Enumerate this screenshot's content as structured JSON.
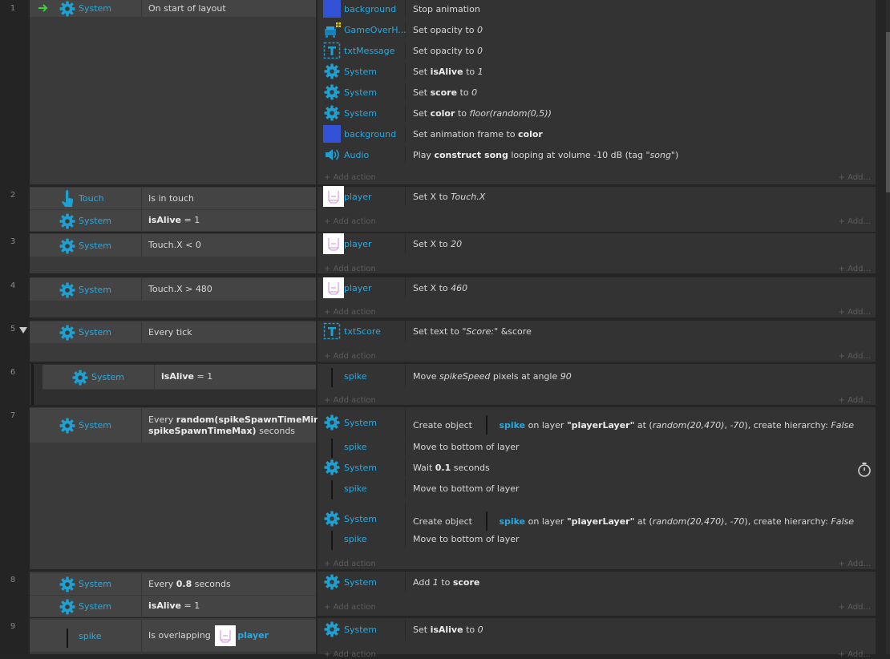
{
  "colors": {
    "object_name": "#29a9e0",
    "gear": "#1fa0d2",
    "background_swatch": "#3353d6",
    "trigger_arrow": "#3ccf3c"
  },
  "add_action": "Add action",
  "add_more": "Add...",
  "events": [
    {
      "num": "1",
      "conditions": [
        {
          "icon": "gear-icon",
          "object": "System",
          "text": "On start of layout",
          "trigger": true
        }
      ],
      "actions": [
        {
          "icon": "color-swatch-icon",
          "object": "background",
          "parts": [
            {
              "t": "Stop animation"
            }
          ]
        },
        {
          "icon": "sprite-icon",
          "object": "GameOverH...",
          "parts": [
            {
              "t": "Set opacity to "
            },
            {
              "t": "0",
              "i": 1
            }
          ]
        },
        {
          "icon": "text-object-icon",
          "object": "txtMessage",
          "parts": [
            {
              "t": "Set opacity to "
            },
            {
              "t": "0",
              "i": 1
            }
          ]
        },
        {
          "icon": "gear-icon",
          "object": "System",
          "parts": [
            {
              "t": "Set "
            },
            {
              "t": "isAlive",
              "b": 1
            },
            {
              "t": " to "
            },
            {
              "t": "1",
              "i": 1
            }
          ]
        },
        {
          "icon": "gear-icon",
          "object": "System",
          "parts": [
            {
              "t": "Set "
            },
            {
              "t": "score",
              "b": 1
            },
            {
              "t": " to "
            },
            {
              "t": "0",
              "i": 1
            }
          ]
        },
        {
          "icon": "gear-icon",
          "object": "System",
          "parts": [
            {
              "t": "Set "
            },
            {
              "t": "color",
              "b": 1
            },
            {
              "t": " to "
            },
            {
              "t": "floor(random(0,5))",
              "i": 1
            }
          ]
        },
        {
          "icon": "color-swatch-icon",
          "object": "background",
          "parts": [
            {
              "t": "Set animation frame to "
            },
            {
              "t": "color",
              "b": 1
            }
          ]
        },
        {
          "icon": "speaker-icon",
          "object": "Audio",
          "parts": [
            {
              "t": "Play "
            },
            {
              "t": "construct song",
              "b": 1
            },
            {
              "t": " looping at volume -10 dB (tag "
            },
            {
              "t": "\"song\"",
              "i": 1
            },
            {
              "t": ")"
            }
          ]
        }
      ]
    },
    {
      "num": "2",
      "conditions": [
        {
          "icon": "touch-icon",
          "object": "Touch",
          "parts": [
            {
              "t": "Is in touch"
            }
          ]
        },
        {
          "icon": "gear-icon",
          "object": "System",
          "parts": [
            {
              "t": "isAlive",
              "b": 1
            },
            {
              "t": " = 1"
            }
          ]
        }
      ],
      "actions": [
        {
          "icon": "player-icon",
          "object": "player",
          "parts": [
            {
              "t": "Set X to "
            },
            {
              "t": "Touch.X",
              "i": 1
            }
          ]
        }
      ]
    },
    {
      "num": "3",
      "conditions": [
        {
          "icon": "gear-icon",
          "object": "System",
          "parts": [
            {
              "t": "Touch.X < 0"
            }
          ]
        }
      ],
      "actions": [
        {
          "icon": "player-icon",
          "object": "player",
          "parts": [
            {
              "t": "Set X to "
            },
            {
              "t": "20",
              "i": 1
            }
          ]
        }
      ]
    },
    {
      "num": "4",
      "conditions": [
        {
          "icon": "gear-icon",
          "object": "System",
          "parts": [
            {
              "t": "Touch.X > 480"
            }
          ]
        }
      ],
      "actions": [
        {
          "icon": "player-icon",
          "object": "player",
          "parts": [
            {
              "t": "Set X to "
            },
            {
              "t": "460",
              "i": 1
            }
          ]
        }
      ]
    },
    {
      "num": "5",
      "collapsible": true,
      "conditions": [
        {
          "icon": "gear-icon",
          "object": "System",
          "parts": [
            {
              "t": "Every tick"
            }
          ]
        }
      ],
      "actions": [
        {
          "icon": "text-object-icon",
          "object": "txtScore",
          "parts": [
            {
              "t": "Set text to "
            },
            {
              "t": "\"Score:\"",
              "i": 1
            },
            {
              "t": " &score"
            }
          ]
        }
      ]
    },
    {
      "num": "6",
      "sub": true,
      "conditions": [
        {
          "icon": "gear-icon",
          "object": "System",
          "parts": [
            {
              "t": "isAlive",
              "b": 1
            },
            {
              "t": " = 1"
            }
          ]
        }
      ],
      "actions": [
        {
          "icon": "spike-icon",
          "object": "spike",
          "parts": [
            {
              "t": "Move "
            },
            {
              "t": "spikeSpeed",
              "i": 1
            },
            {
              "t": " pixels at angle "
            },
            {
              "t": "90",
              "i": 1
            }
          ]
        }
      ]
    },
    {
      "num": "7",
      "conditions": [
        {
          "icon": "gear-icon",
          "object": "System",
          "parts": [
            {
              "t": "Every "
            },
            {
              "t": "random(spikeSpawnTimeMin,",
              "b": 1
            },
            {
              "t": "\n"
            },
            {
              "t": "spikeSpawnTimeMax)",
              "b": 1
            },
            {
              "t": " seconds"
            }
          ]
        }
      ],
      "actions": [
        {
          "icon": "gear-icon",
          "object": "System",
          "create": true,
          "parts": [
            {
              "t": "Create object "
            },
            {
              "t": "spike",
              "blue": 1
            },
            {
              "t": " on layer "
            },
            {
              "t": "\"playerLayer\"",
              "b": 1
            },
            {
              "t": " at ("
            },
            {
              "t": "random(20,470)",
              "i": 1
            },
            {
              "t": ", "
            },
            {
              "t": "-70",
              "i": 1
            },
            {
              "t": "), create hierarchy: "
            },
            {
              "t": "False",
              "i": 1
            }
          ]
        },
        {
          "icon": "spike-icon",
          "object": "spike",
          "parts": [
            {
              "t": "Move to bottom of layer"
            }
          ]
        },
        {
          "icon": "gear-icon",
          "object": "System",
          "parts": [
            {
              "t": "Wait "
            },
            {
              "t": "0.1",
              "b": 1
            },
            {
              "t": " seconds"
            }
          ]
        },
        {
          "icon": "spike-icon",
          "object": "spike",
          "parts": [
            {
              "t": "Move to bottom of layer"
            }
          ]
        },
        {
          "icon": "gear-icon",
          "object": "System",
          "create": true,
          "parts": [
            {
              "t": "Create object "
            },
            {
              "t": "spike",
              "blue": 1
            },
            {
              "t": " on layer "
            },
            {
              "t": "\"playerLayer\"",
              "b": 1
            },
            {
              "t": " at ("
            },
            {
              "t": "random(20,470)",
              "i": 1
            },
            {
              "t": ", "
            },
            {
              "t": "-70",
              "i": 1
            },
            {
              "t": "), create hierarchy: "
            },
            {
              "t": "False",
              "i": 1
            }
          ]
        },
        {
          "icon": "spike-icon",
          "object": "spike",
          "parts": [
            {
              "t": "Move to bottom of layer"
            }
          ]
        }
      ]
    },
    {
      "num": "8",
      "conditions": [
        {
          "icon": "gear-icon",
          "object": "System",
          "parts": [
            {
              "t": "Every "
            },
            {
              "t": "0.8",
              "b": 1
            },
            {
              "t": " seconds"
            }
          ]
        },
        {
          "icon": "gear-icon",
          "object": "System",
          "parts": [
            {
              "t": "isAlive",
              "b": 1
            },
            {
              "t": " = 1"
            }
          ]
        }
      ],
      "actions": [
        {
          "icon": "gear-icon",
          "object": "System",
          "parts": [
            {
              "t": "Add "
            },
            {
              "t": "1",
              "i": 1
            },
            {
              "t": " to "
            },
            {
              "t": "score",
              "b": 1
            }
          ]
        }
      ]
    },
    {
      "num": "9",
      "conditions": [
        {
          "icon": "spike-icon",
          "object": "spike",
          "parts": [
            {
              "t": "Is overlapping "
            },
            {
              "icon": "player-icon"
            },
            {
              "t": "player",
              "blue": 1
            }
          ]
        }
      ],
      "actions": [
        {
          "icon": "gear-icon",
          "object": "System",
          "parts": [
            {
              "t": "Set "
            },
            {
              "t": "isAlive",
              "b": 1
            },
            {
              "t": " to "
            },
            {
              "t": "0",
              "i": 1
            }
          ]
        }
      ]
    }
  ]
}
